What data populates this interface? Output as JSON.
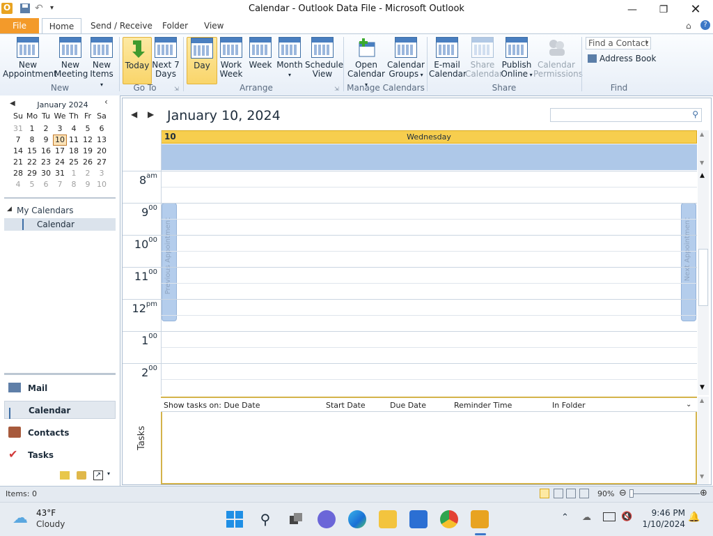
{
  "window": {
    "title": "Calendar - Outlook Data File  -  Microsoft Outlook"
  },
  "tabs": [
    "File",
    "Home",
    "Send / Receive",
    "Folder",
    "View"
  ],
  "ribbon": {
    "new_group": {
      "label": "New",
      "new_appointment": [
        "New",
        "Appointment"
      ],
      "new_meeting": [
        "New",
        "Meeting"
      ],
      "new_items": [
        "New",
        "Items"
      ]
    },
    "goto_group": {
      "label": "Go To",
      "today": "Today",
      "next7": [
        "Next 7",
        "Days"
      ]
    },
    "arrange_group": {
      "label": "Arrange",
      "day": "Day",
      "work_week": [
        "Work",
        "Week"
      ],
      "week": "Week",
      "month": "Month",
      "schedule_view": [
        "Schedule",
        "View"
      ]
    },
    "manage_group": {
      "label": "Manage Calendars",
      "open_calendar": [
        "Open",
        "Calendar"
      ],
      "calendar_groups": [
        "Calendar",
        "Groups"
      ]
    },
    "share_group": {
      "label": "Share",
      "email_calendar": [
        "E-mail",
        "Calendar"
      ],
      "share_calendar": [
        "Share",
        "Calendar"
      ],
      "publish_online": [
        "Publish",
        "Online"
      ],
      "calendar_permissions": [
        "Calendar",
        "Permissions"
      ]
    },
    "find_group": {
      "label": "Find",
      "find_contact_placeholder": "Find a Contact",
      "address_book": "Address Book"
    }
  },
  "mini_calendar": {
    "month": "January 2024",
    "weekdays": [
      "Su",
      "Mo",
      "Tu",
      "We",
      "Th",
      "Fr",
      "Sa"
    ],
    "weeks": [
      [
        "31",
        "1",
        "2",
        "3",
        "4",
        "5",
        "6"
      ],
      [
        "7",
        "8",
        "9",
        "10",
        "11",
        "12",
        "13"
      ],
      [
        "14",
        "15",
        "16",
        "17",
        "18",
        "19",
        "20"
      ],
      [
        "21",
        "22",
        "23",
        "24",
        "25",
        "26",
        "27"
      ],
      [
        "28",
        "29",
        "30",
        "31",
        "1",
        "2",
        "3"
      ],
      [
        "4",
        "5",
        "6",
        "7",
        "8",
        "9",
        "10"
      ]
    ],
    "selected": "10"
  },
  "my_calendars": {
    "header": "My Calendars",
    "items": [
      "Calendar"
    ]
  },
  "nav_buttons": [
    "Mail",
    "Calendar",
    "Contacts",
    "Tasks"
  ],
  "main": {
    "date_title": "January 10, 2024",
    "day_number": "10",
    "day_name": "Wednesday",
    "hours": [
      {
        "h": "8",
        "s": "am"
      },
      {
        "h": "9",
        "s": "00"
      },
      {
        "h": "10",
        "s": "00"
      },
      {
        "h": "11",
        "s": "00"
      },
      {
        "h": "12",
        "s": "pm"
      },
      {
        "h": "1",
        "s": "00"
      },
      {
        "h": "2",
        "s": "00"
      }
    ],
    "previous_appointment": "Previous Appointment",
    "next_appointment": "Next Appointment",
    "tasks_label": "Tasks",
    "tasks_header": {
      "show": "Show tasks on: Due Date",
      "start": "Start Date",
      "due": "Due Date",
      "reminder": "Reminder Time",
      "folder": "In Folder"
    }
  },
  "status": {
    "items": "Items: 0",
    "zoom": "90%"
  },
  "taskbar": {
    "weather_temp": "43°F",
    "weather_desc": "Cloudy",
    "time": "9:46 PM",
    "date": "1/10/2024"
  },
  "colors": {
    "accent": "#f7ce4e",
    "file_tab": "#f39a2a",
    "allday": "#aec8e8"
  }
}
